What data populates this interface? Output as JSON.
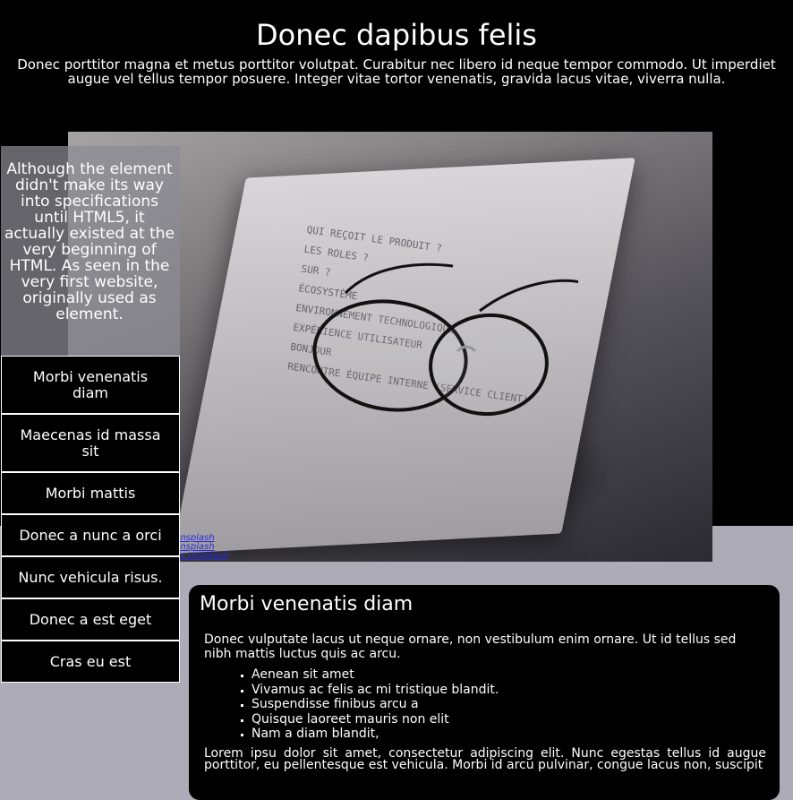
{
  "header": {
    "title": "Donec dapibus felis",
    "subtitle": "Donec porttitor magna et metus porttitor volutpat. Curabitur nec libero id neque tempor commodo. Ut imperdiet augue vel tellus tempor posuere. Integer vitae tortor venenatis, gravida lacus vitae, viverra nulla."
  },
  "aside": {
    "text": "Although the element didn't make its way into specifications until HTML5, it actually existed at the very beginning of HTML. As seen in the very first website, originally used as element."
  },
  "nav": {
    "items": [
      {
        "label": "Morbi venenatis diam"
      },
      {
        "label": "Maecenas id massa sit"
      },
      {
        "label": "Morbi mattis"
      },
      {
        "label": "Donec a nunc a orci"
      },
      {
        "label": "Nunc vehicula risus."
      },
      {
        "label": "Donec a est eget"
      },
      {
        "label": "Cras eu est"
      }
    ]
  },
  "hero": {
    "icon": "photo-glasses-on-notebook",
    "notebook_text": [
      "QUI REÇOIT LE PRODUIT ?",
      "LES ROLES ?",
      "SUR ?",
      "ÉCOSYSTÈME",
      "ENVIRONNEMENT TECHNOLOGIQUE",
      "EXPÉRIENCE UTILISATEUR",
      "BONJOUR",
      "RENCONTRE ÉQUIPE INTERNE (SERVICE CLIENT)"
    ],
    "credits": [
      "Unsplash",
      "Unsplash",
      "on Unsplash"
    ]
  },
  "content": {
    "title": "Morbi venenatis diam",
    "intro": "Donec vulputate lacus ut neque ornare, non vestibulum enim ornare. Ut id tellus sed nibh mattis luctus quis ac arcu.",
    "list": [
      "Aenean sit amet",
      "Vivamus ac felis ac mi tristique blandit.",
      "Suspendisse finibus arcu a",
      "Quisque laoreet mauris non elit",
      "Nam a diam blandit,"
    ],
    "paragraph": "Lorem ipsu dolor sit amet, consectetur adipiscing elit. Nunc egestas tellus id augue porttitor, eu pellentesque est vehicula. Morbi id arcu pulvinar, congue lacus non, suscipit"
  },
  "colors": {
    "page_background": "#acabb6",
    "header_background": "#000000",
    "link": "#2a2ad8"
  }
}
